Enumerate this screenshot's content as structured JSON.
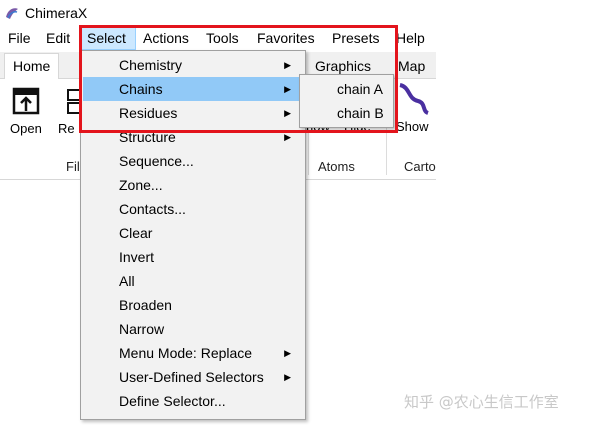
{
  "window": {
    "title": "ChimeraX"
  },
  "menubar": {
    "items": [
      "File",
      "Edit",
      "Select",
      "Actions",
      "Tools",
      "Favorites",
      "Presets",
      "Help"
    ]
  },
  "ribbon": {
    "tabs": [
      "Home",
      "Graphics",
      "Map"
    ],
    "buttons": {
      "open": "Open",
      "recent": "Re",
      "show": "how",
      "hide": "Hide",
      "show2": "Show"
    },
    "groups": {
      "file": "Fil",
      "atoms": "Atoms",
      "cartoons": "Carto"
    }
  },
  "select_menu": {
    "items": [
      {
        "label": "Chemistry",
        "submenu": true
      },
      {
        "label": "Chains",
        "submenu": true
      },
      {
        "label": "Residues",
        "submenu": true
      },
      {
        "label": "Structure",
        "submenu": true
      },
      {
        "label": "Sequence...",
        "submenu": false
      },
      {
        "label": "Zone...",
        "submenu": false
      },
      {
        "label": "Contacts...",
        "submenu": false
      },
      {
        "label": "Clear",
        "submenu": false
      },
      {
        "label": "Invert",
        "submenu": false
      },
      {
        "label": "All",
        "submenu": false
      },
      {
        "label": "Broaden",
        "submenu": false
      },
      {
        "label": "Narrow",
        "submenu": false
      },
      {
        "label": "Menu Mode: Replace",
        "submenu": true
      },
      {
        "label": "User-Defined Selectors",
        "submenu": true
      },
      {
        "label": "Define Selector...",
        "submenu": false
      }
    ],
    "highlighted_index": 1
  },
  "chains_submenu": {
    "items": [
      "chain A",
      "chain B"
    ]
  },
  "colors": {
    "highlight": "#91c9f7",
    "annotation_box": "#e3141c"
  },
  "watermark": "知乎 @农心生信工作室"
}
